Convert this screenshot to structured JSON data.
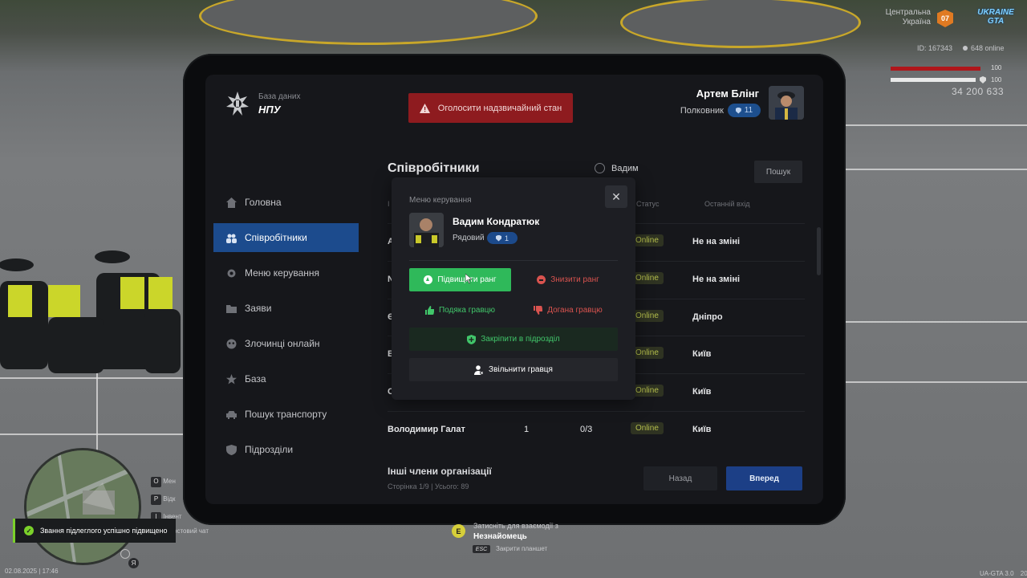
{
  "hud": {
    "region_line1": "Центральна",
    "region_line2": "Україна",
    "region_code": "07",
    "server_logo": "UKRAINE GTA",
    "player_id": "ID: 167343",
    "online": "648 online",
    "health": "100",
    "armor": "100",
    "money": "34 200 633",
    "datetime": "02.08.2025 | 17:46",
    "version": "UA-GTA 3.0",
    "version_suffix": "20",
    "notification": "Звання підлеглого успішно підвищено",
    "interact_key": "E",
    "interact_text": "Затисніть для взаємодії з",
    "interact_target": "Незнайомець",
    "esc_key": "ESC",
    "esc_text": "Закрити планшет",
    "side_keys": [
      {
        "key": "O",
        "label": "Мен"
      },
      {
        "key": "P",
        "label": "Відк"
      },
      {
        "key": "I",
        "label": "Інвент"
      }
    ],
    "chat_hint": "остовий чат",
    "voice_key": "Я"
  },
  "brand": {
    "sub": "База даних",
    "main": "НПУ"
  },
  "emergency_label": "Оголосити надзвичайний стан",
  "user": {
    "name": "Артем Блінг",
    "rank": "Полковник",
    "rank_level": "11"
  },
  "nav": [
    {
      "label": "Головна",
      "icon": "home-icon"
    },
    {
      "label": "Співробітники",
      "icon": "users-icon",
      "active": true
    },
    {
      "label": "Меню керування",
      "icon": "gear-icon"
    },
    {
      "label": "Заяви",
      "icon": "folder-icon"
    },
    {
      "label": "Злочинці онлайн",
      "icon": "mask-icon"
    },
    {
      "label": "База",
      "icon": "star-icon"
    },
    {
      "label": "Пошук транспорту",
      "icon": "car-icon"
    },
    {
      "label": "Підрозділи",
      "icon": "shield-icon"
    }
  ],
  "employees": {
    "title": "Співробітники",
    "search_value": "Вадим",
    "search_button": "Пошук",
    "columns": {
      "id_fragment": "І",
      "status": "Статус",
      "last_login": "Останній вхід"
    },
    "rows": [
      {
        "name": "А",
        "rank": "",
        "warns": "",
        "status": "Online",
        "location": "Не на зміні"
      },
      {
        "name": "N",
        "rank": "",
        "warns": "",
        "status": "Online",
        "location": "Не на зміні"
      },
      {
        "name": "Є",
        "rank": "",
        "warns": "",
        "status": "Online",
        "location": "Дніпро"
      },
      {
        "name": "В",
        "rank": "",
        "warns": "",
        "status": "Online",
        "location": "Київ"
      },
      {
        "name": "С",
        "rank": "",
        "warns": "",
        "status": "Online",
        "location": "Київ"
      },
      {
        "name": "Володимир Галат",
        "rank": "1",
        "warns": "0/3",
        "status": "Online",
        "location": "Київ"
      }
    ],
    "other_title": "Інші члени організації",
    "page_info": "Сторінка 1/9 | Усього: 89",
    "back_label": "Назад",
    "next_label": "Вперед"
  },
  "modal": {
    "label": "Меню керування",
    "name": "Вадим Кондратюк",
    "rank": "Рядовий",
    "rank_level": "1",
    "promote": "Підвищити ранг",
    "demote": "Знизити ранг",
    "thanks": "Подяка гравцю",
    "reprimand": "Догана гравцю",
    "assign": "Закріпити в підрозділ",
    "fire": "Звільнити гравця"
  },
  "colors": {
    "accent": "#1c4b8d",
    "promote": "#2fb95a",
    "danger": "#d9534f",
    "emergency": "#8e1b1f"
  }
}
